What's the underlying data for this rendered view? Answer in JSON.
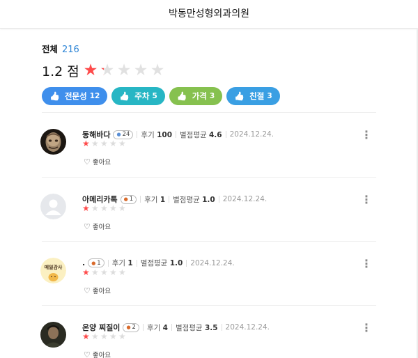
{
  "header": {
    "title": "박동만성형외과의원"
  },
  "summary": {
    "total_label": "전체",
    "total_count": "216",
    "score_text": "1.2 점",
    "rating": 1.2,
    "max_rating": 5,
    "star_color": "#ff4b4b"
  },
  "keywords": [
    {
      "label": "전문성",
      "count": "12",
      "color": "#3f8fec"
    },
    {
      "label": "주차",
      "count": "5",
      "color": "#27b6c4"
    },
    {
      "label": "가격",
      "count": "3",
      "color": "#86c14f"
    },
    {
      "label": "친절",
      "count": "3",
      "color": "#3a9fe3"
    }
  ],
  "reviews": [
    {
      "nickname": "동해바다",
      "badge": "24",
      "badge_icon": "leaf-icon",
      "reviews_label": "후기",
      "reviews_count": "100",
      "avg_label": "별점평균",
      "avg_value": "4.6",
      "date": "2024.12.24.",
      "rating": 1,
      "like_label": "좋아요",
      "avatar": "mask-photo"
    },
    {
      "nickname": "아메리카톡",
      "badge": "1",
      "badge_icon": "sprout-icon",
      "reviews_label": "후기",
      "reviews_count": "1",
      "avg_label": "별점평균",
      "avg_value": "1.0",
      "date": "2024.12.24.",
      "rating": 1,
      "like_label": "좋아요",
      "avatar": "default-avatar"
    },
    {
      "nickname": ".",
      "badge": "1",
      "badge_icon": "sprout-icon",
      "reviews_label": "후기",
      "reviews_count": "1",
      "avg_label": "별점평균",
      "avg_value": "1.0",
      "date": "2024.12.24.",
      "rating": 1,
      "like_label": "좋아요",
      "avatar": "character-avatar",
      "avatar_text": "매일감사"
    },
    {
      "nickname": "온양 찌질이",
      "badge": "2",
      "badge_icon": "sprout-icon",
      "reviews_label": "후기",
      "reviews_count": "4",
      "avg_label": "별점평균",
      "avg_value": "3.5",
      "date": "2024.12.24.",
      "rating": 1,
      "like_label": "좋아요",
      "avatar": "person-photo"
    }
  ]
}
